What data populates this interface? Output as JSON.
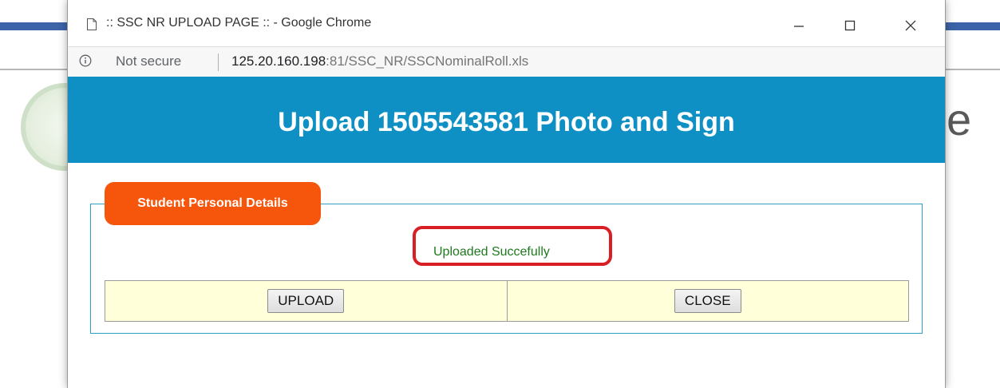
{
  "browser": {
    "window_title": ":: SSC NR UPLOAD PAGE :: - Google Chrome",
    "security_label": "Not secure",
    "url_host": "125.20.160.198",
    "url_path": ":81/SSC_NR/SSCNominalRoll.xls"
  },
  "page": {
    "header_title": "Upload 1505543581 Photo and Sign",
    "section_legend": "Student Personal Details",
    "status_message": "Uploaded Succefully",
    "upload_button_label": "UPLOAD",
    "close_button_label": "CLOSE"
  },
  "background_page": {
    "partial_letter": "e"
  },
  "colors": {
    "header_band": "#0f90c5",
    "legend_tab": "#f5560c",
    "status_text": "#1e7a1e",
    "highlight_ring": "#d81f26",
    "button_row_bg": "#ffffd9"
  },
  "icons": {
    "page": "page-icon",
    "minimize": "minimize-icon",
    "maximize": "maximize-icon",
    "close": "close-icon",
    "info": "info-icon"
  }
}
